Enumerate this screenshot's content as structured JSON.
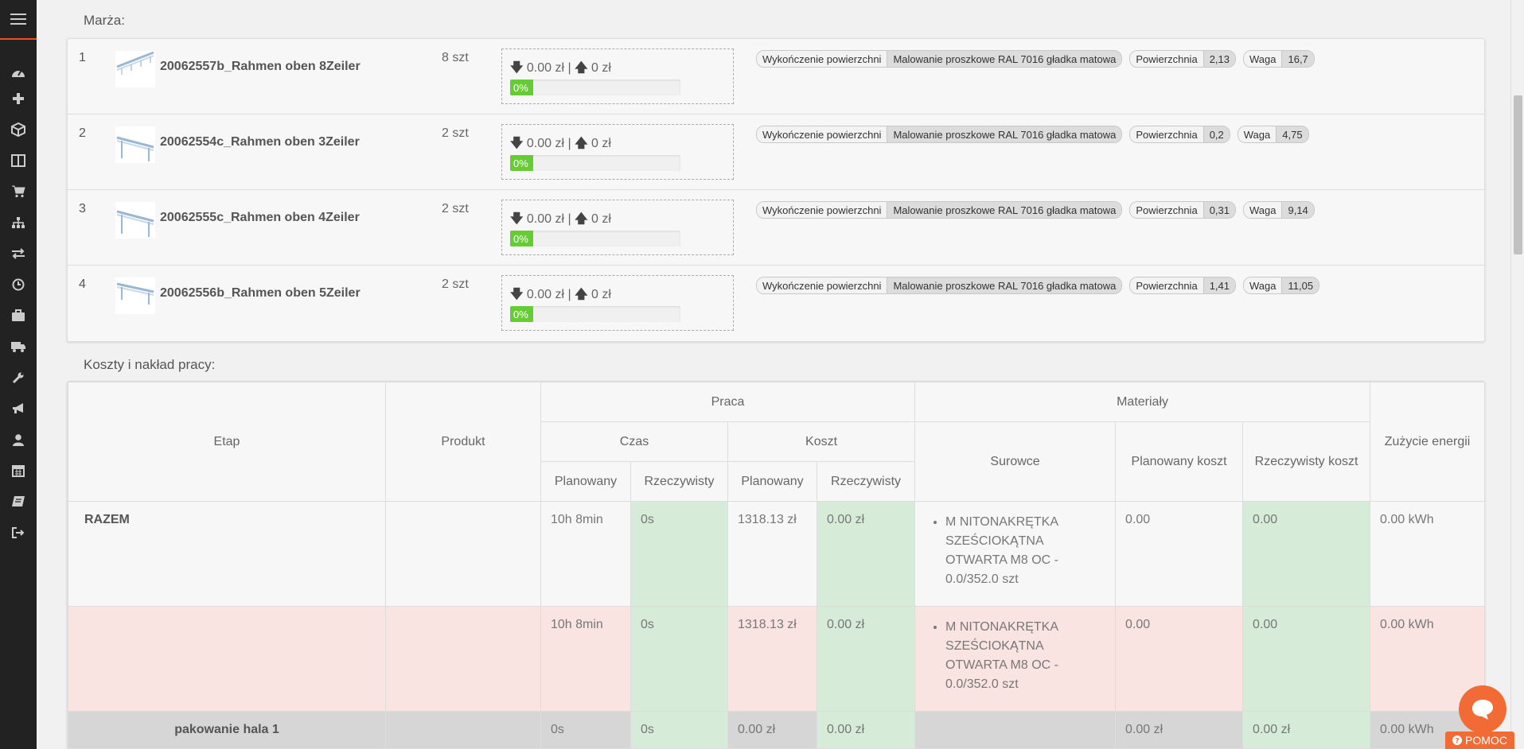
{
  "sidebar": {
    "menu_icon": "hamburger-icon",
    "icons": [
      "dashboard-icon",
      "plus-icon",
      "cube-icon",
      "columns-icon",
      "cart-icon",
      "sitemap-icon",
      "exchange-icon",
      "clock-icon",
      "briefcase-icon",
      "truck-icon",
      "wrench-icon",
      "bullhorn-icon",
      "user-icon",
      "calendar-icon",
      "book-icon",
      "sign-out-icon"
    ]
  },
  "marza": {
    "label": "Marża:",
    "items": [
      {
        "num": "1",
        "name": "20062557b_Rahmen oben 8Zeiler",
        "qty": "8 szt",
        "down": "0.00 zł",
        "up": "0 zł",
        "progress": "0%",
        "sep": "|",
        "tags": [
          {
            "k": "Wykończenie powierzchni",
            "v": "Malowanie proszkowe RAL 7016 gładka matowa"
          },
          {
            "k": "Powierzchnia",
            "v": "2,13"
          },
          {
            "k": "Waga",
            "v": "16,7"
          }
        ]
      },
      {
        "num": "2",
        "name": "20062554c_Rahmen oben 3Zeiler",
        "qty": "2 szt",
        "down": "0.00 zł",
        "up": "0 zł",
        "progress": "0%",
        "sep": "|",
        "tags": [
          {
            "k": "Wykończenie powierzchni",
            "v": "Malowanie proszkowe RAL 7016 gładka matowa"
          },
          {
            "k": "Powierzchnia",
            "v": "0,2"
          },
          {
            "k": "Waga",
            "v": "4,75"
          }
        ]
      },
      {
        "num": "3",
        "name": "20062555c_Rahmen oben 4Zeiler",
        "qty": "2 szt",
        "down": "0.00 zł",
        "up": "0 zł",
        "progress": "0%",
        "sep": "|",
        "tags": [
          {
            "k": "Wykończenie powierzchni",
            "v": "Malowanie proszkowe RAL 7016 gładka matowa"
          },
          {
            "k": "Powierzchnia",
            "v": "0,31"
          },
          {
            "k": "Waga",
            "v": "9,14"
          }
        ]
      },
      {
        "num": "4",
        "name": "20062556b_Rahmen oben 5Zeiler",
        "qty": "2 szt",
        "down": "0.00 zł",
        "up": "0 zł",
        "progress": "0%",
        "sep": "|",
        "tags": [
          {
            "k": "Wykończenie powierzchni",
            "v": "Malowanie proszkowe RAL 7016 gładka matowa"
          },
          {
            "k": "Powierzchnia",
            "v": "1,41"
          },
          {
            "k": "Waga",
            "v": "11,05"
          }
        ]
      }
    ]
  },
  "costs": {
    "label": "Koszty i nakład pracy:",
    "headers": {
      "etap": "Etap",
      "produkt": "Produkt",
      "praca": "Praca",
      "materialy": "Materiały",
      "zuzycie": "Zużycie energii",
      "czas": "Czas",
      "koszt": "Koszt",
      "planowany": "Planowany",
      "rzeczywisty": "Rzeczywisty",
      "surowce": "Surowce",
      "plan_koszt": "Planowany koszt",
      "rzecz_koszt": "Rzeczywisty koszt"
    },
    "rows": {
      "total": {
        "etap": "RAZEM",
        "czas_plan": "10h 8min",
        "czas_rz": "0s",
        "koszt_plan": "1318.13 zł",
        "koszt_rz": "0.00 zł",
        "surowce": "M NITONAKRĘTKA SZEŚCIOKĄTNA OTWARTA M8 OC - 0.0/352.0 szt",
        "plan_koszt": "0.00",
        "rzecz_koszt": "0.00",
        "energia": "0.00 kWh"
      },
      "pink": {
        "czas_plan": "10h 8min",
        "czas_rz": "0s",
        "koszt_plan": "1318.13 zł",
        "koszt_rz": "0.00 zł",
        "surowce": "M NITONAKRĘTKA SZEŚCIOKĄTNA OTWARTA M8 OC - 0.0/352.0 szt",
        "plan_koszt": "0.00",
        "rzecz_koszt": "0.00",
        "energia": "0.00 kWh"
      },
      "grey": {
        "etap": "pakowanie hala 1",
        "czas_plan": "0s",
        "czas_rz": "0s",
        "koszt_plan": "0.00 zł",
        "koszt_rz": "0.00 zł",
        "plan_koszt": "0.00 zł",
        "rzecz_koszt": "0.00 zł",
        "energia": "0.00 kWh"
      }
    }
  },
  "help": {
    "label": "POMOC",
    "chat_icon": "chat-icon",
    "question_icon": "question-circle-icon"
  },
  "colors": {
    "accent": "#f26b35",
    "progress": "#66cc33",
    "green_cell": "#d6ecd9",
    "pink_row": "#f9e4e2"
  }
}
